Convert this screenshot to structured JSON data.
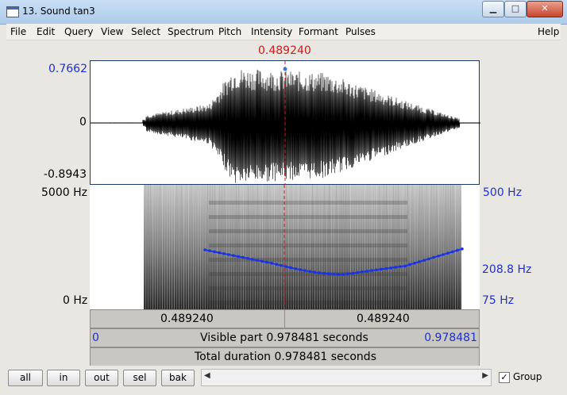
{
  "window": {
    "title": "13. Sound tan3"
  },
  "menu": [
    "File",
    "Edit",
    "Query",
    "View",
    "Select",
    "Spectrum",
    "Pitch",
    "Intensity",
    "Formant",
    "Pulses",
    "Help"
  ],
  "cursor": {
    "time_label": "0.489240"
  },
  "waveform": {
    "max_label": "0.7662",
    "zero_label": "0",
    "min_label": "-0.8943"
  },
  "spectrogram": {
    "top_freq_label": "5000 Hz",
    "bottom_freq_label": "0 Hz"
  },
  "pitch": {
    "top_label": "500 Hz",
    "value_label": "208.8 Hz",
    "bottom_label": "75 Hz"
  },
  "time_bars": {
    "left_segment": "0.489240",
    "right_segment": "0.489240",
    "visible_start": "0",
    "visible_label": "Visible part 0.978481 seconds",
    "visible_end": "0.978481",
    "total_label": "Total duration 0.978481 seconds"
  },
  "buttons": {
    "all": "all",
    "in": "in",
    "out": "out",
    "sel": "sel",
    "bak": "bak"
  },
  "group": {
    "label": "Group",
    "checked": "✓"
  },
  "colors": {
    "cursor": "#d21a1a",
    "axis_blue": "#1f2fd0",
    "pitch": "#1a33e6"
  }
}
